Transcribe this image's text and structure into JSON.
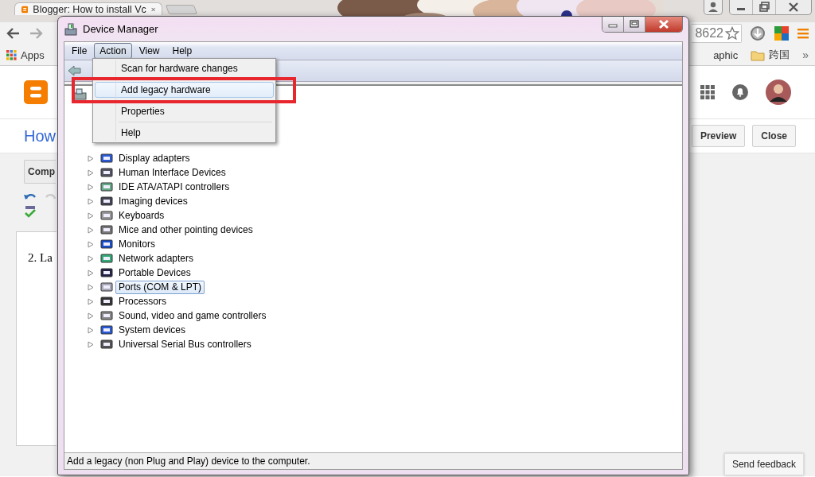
{
  "browser": {
    "tab_title": "Blogger: How to install Vc",
    "address_fragment": "8622",
    "bookmarks": [
      {
        "kind": "apps",
        "label": "Apps"
      },
      {
        "kind": "link",
        "label": "aphic"
      },
      {
        "kind": "folder",
        "label": "跨国"
      }
    ],
    "bookmarks_overflow": "»",
    "post_title": "How",
    "compose_button": "Comp",
    "preview_button": "Preview",
    "close_button": "Close",
    "editor_text": "2. La",
    "feedback_button": "Send feedback"
  },
  "device_manager": {
    "title": "Device Manager",
    "menu": [
      {
        "label": "File",
        "selected": false
      },
      {
        "label": "Action",
        "selected": true
      },
      {
        "label": "View",
        "selected": false
      },
      {
        "label": "Help",
        "selected": false
      }
    ],
    "action_menu": [
      {
        "label": "Scan for hardware changes",
        "highlighted": false
      },
      {
        "label": "Add legacy hardware",
        "highlighted": true
      },
      {
        "label": "Properties",
        "highlighted": false
      },
      {
        "label": "Help",
        "highlighted": false
      }
    ],
    "categories": [
      {
        "label": "Display adapters",
        "selected": false
      },
      {
        "label": "Human Interface Devices",
        "selected": false
      },
      {
        "label": "IDE ATA/ATAPI controllers",
        "selected": false
      },
      {
        "label": "Imaging devices",
        "selected": false
      },
      {
        "label": "Keyboards",
        "selected": false
      },
      {
        "label": "Mice and other pointing devices",
        "selected": false
      },
      {
        "label": "Monitors",
        "selected": false
      },
      {
        "label": "Network adapters",
        "selected": false
      },
      {
        "label": "Portable Devices",
        "selected": false
      },
      {
        "label": "Ports (COM & LPT)",
        "selected": true
      },
      {
        "label": "Processors",
        "selected": false
      },
      {
        "label": "Sound, video and game controllers",
        "selected": false
      },
      {
        "label": "System devices",
        "selected": false
      },
      {
        "label": "Universal Serial Bus controllers",
        "selected": false
      }
    ],
    "status": "Add a legacy (non Plug and Play) device to the computer."
  }
}
